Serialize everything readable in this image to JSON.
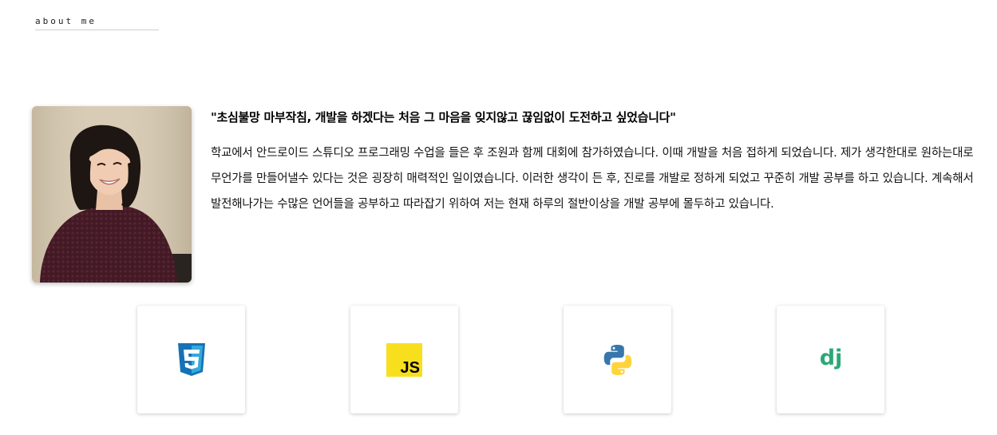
{
  "section": {
    "label": "about me"
  },
  "profile": {
    "avatar_alt": "profile photo",
    "quote": "\"초심불망 마부작침, 개발을 하겠다는 처음 그 마음을 잊지않고 끊임없이 도전하고 싶었습니다\"",
    "description": "학교에서 안드로이드 스튜디오 프로그래밍 수업을 들은 후 조원과 함께 대회에 참가하였습니다. 이때 개발을 처음 접하게 되었습니다. 제가 생각한대로 원하는대로 무언가를 만들어낼수 있다는 것은 굉장히 매력적인 일이였습니다. 이러한 생각이 든 후, 진로를 개발로 정하게 되었고 꾸준히 개발 공부를 하고 있습니다. 계속해서 발전해나가는 수많은 언어들을 공부하고 따라잡기 위하여 저는 현재 하루의 절반이상을 개발 공부에 몰두하고 있습니다."
  },
  "skills": [
    {
      "icon": "css3-icon",
      "color": "#1572b6"
    },
    {
      "icon": "javascript-icon",
      "color": "#f7df1e",
      "text": "JS"
    },
    {
      "icon": "python-icon",
      "colors": [
        "#3776ab",
        "#ffd43b"
      ]
    },
    {
      "icon": "django-icon",
      "color": "#2ba977",
      "text": "dj"
    }
  ]
}
